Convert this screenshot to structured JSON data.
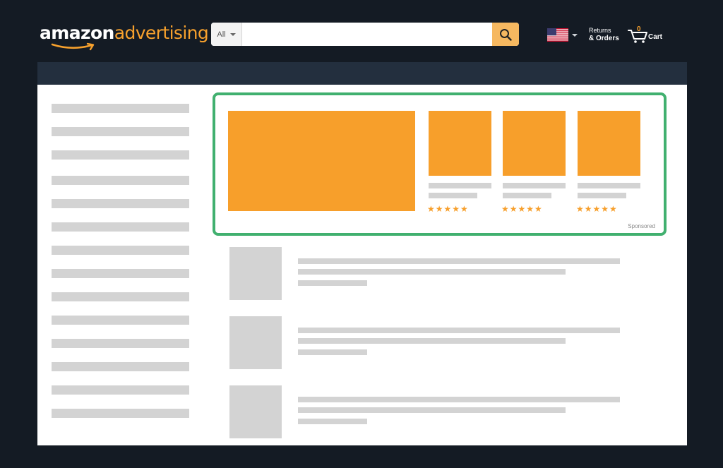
{
  "header": {
    "logo": {
      "part1": "amazon",
      "part2": "advertising"
    },
    "search": {
      "category": "All",
      "placeholder": "",
      "value": ""
    },
    "locale": {
      "flag": "us-flag-icon"
    },
    "returns": {
      "line1": "Returns",
      "line2": "& Orders"
    },
    "cart": {
      "count": "0",
      "label": "Cart"
    }
  },
  "sponsored": {
    "label": "Sponsored",
    "products": [
      {
        "rating": 5
      },
      {
        "rating": 5
      },
      {
        "rating": 5
      }
    ]
  },
  "sidebar": {
    "placeholder_rows": 14
  },
  "results": {
    "placeholder_items": 3
  },
  "colors": {
    "background": "#141b24",
    "nav": "#232f3e",
    "accent": "#f79f2b",
    "highlight_border": "#41b06f",
    "placeholder": "#d3d3d3"
  }
}
